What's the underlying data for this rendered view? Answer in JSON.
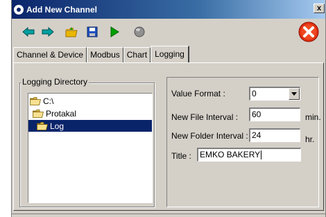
{
  "window": {
    "title": "Add New Channel",
    "close_label": "x"
  },
  "toolbar": {
    "buttons": [
      {
        "icon": "arrow-left-icon",
        "color": "#00a0a0"
      },
      {
        "icon": "arrow-right-icon",
        "color": "#00a0a0"
      },
      {
        "icon": "open-folder-icon",
        "color": "#e8b800"
      },
      {
        "icon": "save-icon",
        "color": "#2050c0"
      },
      {
        "icon": "play-icon",
        "color": "#00a000"
      },
      {
        "icon": "stop-icon",
        "color": "#707070"
      }
    ],
    "close_icon_color": "#e03010"
  },
  "tabs": [
    {
      "label": "Channel & Device",
      "active": false
    },
    {
      "label": "Modbus",
      "active": false
    },
    {
      "label": "Chart",
      "active": false
    },
    {
      "label": "Logging",
      "active": true
    }
  ],
  "logging_directory": {
    "group_label": "Logging Directory",
    "tree": [
      {
        "label": "C:\\",
        "level": 0,
        "selected": false
      },
      {
        "label": "Protakal",
        "level": 1,
        "selected": false
      },
      {
        "label": "Log",
        "level": 2,
        "selected": true
      }
    ]
  },
  "settings": {
    "value_format": {
      "label": "Value Format :",
      "value": "0"
    },
    "new_file_interval": {
      "label": "New File Interval :",
      "value": "60",
      "unit": "min."
    },
    "new_folder_interval": {
      "label": "New Folder Interval :",
      "value": "24",
      "unit": "hr."
    },
    "title": {
      "label": "Title :",
      "value": "EMKO BAKERY"
    }
  },
  "colors": {
    "selection": "#0a246a",
    "face": "#d4d0c8",
    "titlebar": "#0a246a"
  }
}
